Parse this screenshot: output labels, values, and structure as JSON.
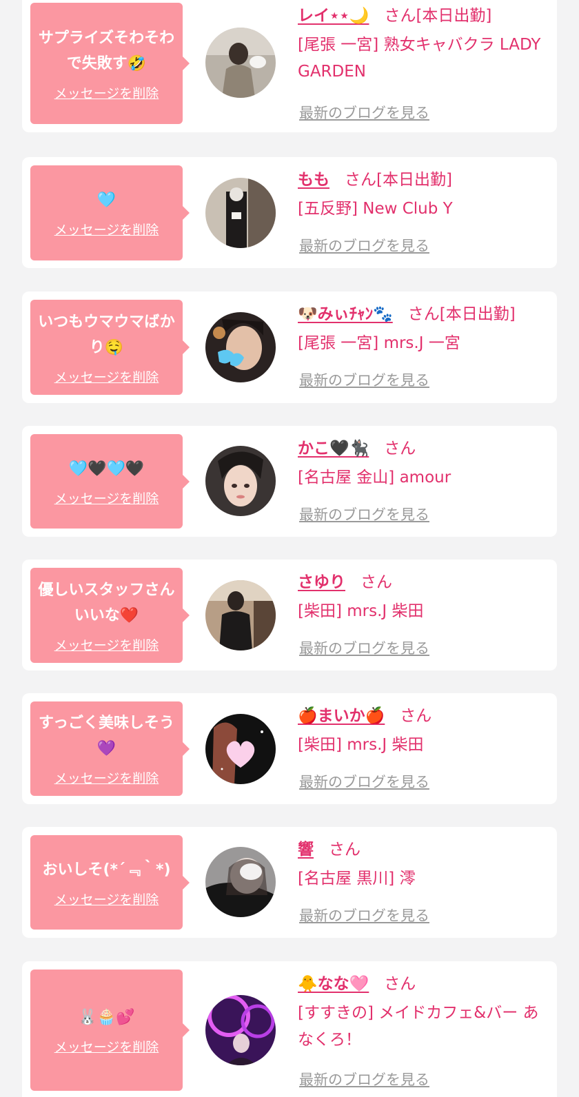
{
  "messages": [
    {
      "message": "サプライズそわそわで失敗す🤣",
      "delete_label": "メッセージを削除",
      "name": "レイ⋆⋆🌙",
      "status": "さん[本日出勤]",
      "shop": "[尾張 一宮] 熟女キャバクラ LADY GARDEN",
      "blog_label": "最新のブログを見る"
    },
    {
      "message": "🩵",
      "delete_label": "メッセージを削除",
      "name": "もも",
      "status": "さん[本日出勤]",
      "shop": "[五反野] New Club Y",
      "blog_label": "最新のブログを見る"
    },
    {
      "message": "いつもウマウマばかり🤤",
      "delete_label": "メッセージを削除",
      "name": "🐶みぃﾁｬﾝ🐾",
      "status": "さん[本日出勤]",
      "shop": "[尾張 一宮] mrs.J 一宮",
      "blog_label": "最新のブログを見る"
    },
    {
      "message": "🩵🖤🩵🖤",
      "delete_label": "メッセージを削除",
      "name": "かこ🖤🐈‍⬛",
      "status": "さん",
      "shop": "[名古屋 金山] amour",
      "blog_label": "最新のブログを見る"
    },
    {
      "message": "優しいスタッフさんいいな❤️",
      "delete_label": "メッセージを削除",
      "name": "さゆり",
      "status": "さん",
      "shop": "[柴田] mrs.J 柴田",
      "blog_label": "最新のブログを見る"
    },
    {
      "message": "すっごく美味しそう💜",
      "delete_label": "メッセージを削除",
      "name": "🍎まいか🍎",
      "status": "さん",
      "shop": "[柴田] mrs.J 柴田",
      "blog_label": "最新のブログを見る"
    },
    {
      "message": "おいしそ(*´﹃｀*)",
      "delete_label": "メッセージを削除",
      "name": "響",
      "status": "さん",
      "shop": "[名古屋 黒川] 澪",
      "blog_label": "最新のブログを見る"
    },
    {
      "message": "🐰🧁💕",
      "delete_label": "メッセージを削除",
      "name": "🐥なな🩷",
      "status": "さん",
      "shop": "[すすきの] メイドカフェ&バー あなくろ！",
      "blog_label": "最新のブログを見る"
    }
  ],
  "colors": {
    "accent": "#e2306c",
    "bubble": "#fb97a1",
    "background": "#f3f3f4",
    "muted_link": "#9a9a9a"
  }
}
